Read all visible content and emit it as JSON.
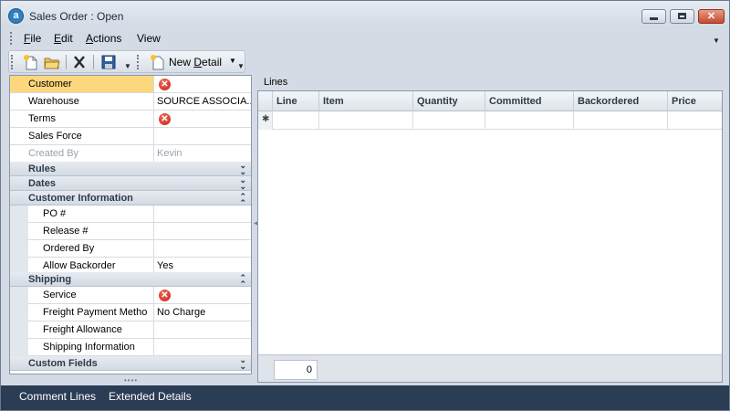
{
  "window": {
    "app_icon_letter": "a",
    "title": "Sales Order  : Open"
  },
  "menubar": {
    "items": [
      {
        "label": "File",
        "underline": "F",
        "rest": "ile"
      },
      {
        "label": "Edit",
        "underline": "E",
        "rest": "dit"
      },
      {
        "label": "Actions",
        "underline": "A",
        "rest": "ctions"
      },
      {
        "label": "View"
      }
    ]
  },
  "toolbar": {
    "new_detail_prefix": "New ",
    "new_detail_underline": "D",
    "new_detail_rest": "etail"
  },
  "properties": {
    "customer": {
      "label": "Customer",
      "value": ""
    },
    "warehouse": {
      "label": "Warehouse",
      "value": "SOURCE ASSOCIA..."
    },
    "terms": {
      "label": "Terms",
      "value": ""
    },
    "sales_force": {
      "label": "Sales Force",
      "value": ""
    },
    "created_by": {
      "label": "Created By",
      "value": "Kevin"
    },
    "sections": {
      "rules": "Rules",
      "dates": "Dates",
      "customer_information": "Customer Information",
      "shipping": "Shipping",
      "custom_fields": "Custom Fields"
    },
    "customer_information": {
      "po": {
        "label": "PO #",
        "value": ""
      },
      "release": {
        "label": "Release #",
        "value": ""
      },
      "ordered_by": {
        "label": "Ordered By",
        "value": ""
      },
      "allow_backorder": {
        "label": "Allow Backorder",
        "value": "Yes"
      }
    },
    "shipping": {
      "service": {
        "label": "Service",
        "value": ""
      },
      "freight_payment": {
        "label": "Freight Payment Metho",
        "value": "No Charge"
      },
      "freight_allowance": {
        "label": "Freight Allowance",
        "value": ""
      },
      "shipping_information": {
        "label": "Shipping Information",
        "value": ""
      }
    }
  },
  "lines": {
    "title": "Lines",
    "columns": [
      "Line",
      "Item",
      "Quantity",
      "Committed",
      "Backordered",
      "Price"
    ],
    "new_row_marker": "✱",
    "count": "0"
  },
  "bottom_tabs": [
    "Comment Lines",
    "Extended Details"
  ],
  "colors": {
    "selected_row": "#fcd77e",
    "error_icon": "#c22212",
    "bottom_bar": "#2b3d55"
  }
}
